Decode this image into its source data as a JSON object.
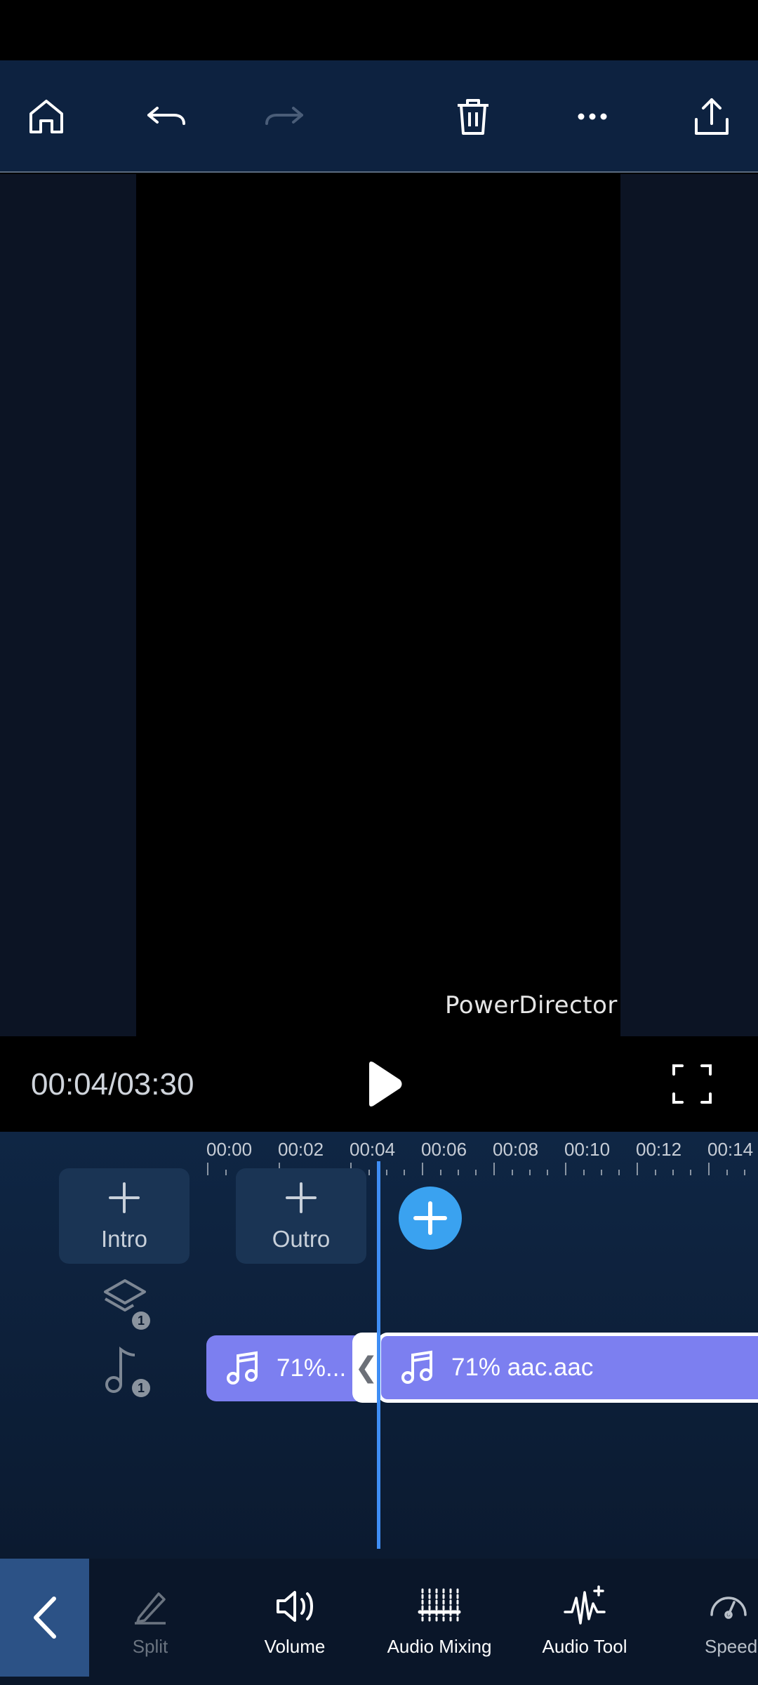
{
  "toolbar": {
    "icons": [
      "home-icon",
      "undo-icon",
      "redo-icon",
      "delete-icon",
      "more-icon",
      "share-icon"
    ],
    "redo_enabled": false
  },
  "preview": {
    "watermark": "PowerDirector"
  },
  "playback": {
    "timecode": "00:04/03:30"
  },
  "timeline": {
    "ruler": [
      "00:00",
      "00:02",
      "00:04",
      "00:06",
      "00:08",
      "00:10",
      "00:12",
      "00:14"
    ],
    "intro_label": "Intro",
    "outro_label": "Outro",
    "layer_count": "1",
    "audio_track_count": "1",
    "clips": [
      {
        "label": "71%..."
      },
      {
        "label": "71% aac.aac"
      }
    ],
    "trim_handle": "❮"
  },
  "bottom_tools": {
    "items": [
      {
        "label": "Split",
        "icon": "split-icon",
        "enabled": false
      },
      {
        "label": "Volume",
        "icon": "volume-icon",
        "enabled": true
      },
      {
        "label": "Audio Mixing",
        "icon": "audio-mixing-icon",
        "enabled": true
      },
      {
        "label": "Audio Tool",
        "icon": "audio-tool-icon",
        "enabled": true
      },
      {
        "label": "Speed",
        "icon": "speed-icon",
        "enabled": true
      }
    ]
  },
  "colors": {
    "accent": "#3aa2f0",
    "clip": "#7c7ff0",
    "playhead": "#3f8ef5",
    "toolbar_bg": "#0d2240"
  }
}
